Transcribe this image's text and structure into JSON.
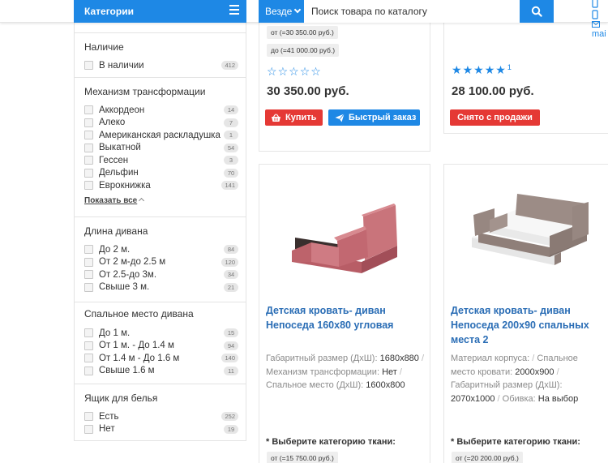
{
  "header": {
    "categories_label": "Категории",
    "search_scope": "Везде",
    "search_placeholder": "Поиск товара по каталогу",
    "mail_label": "mai"
  },
  "filters": {
    "availability": {
      "title": "Наличие",
      "options": [
        {
          "label": "В наличии",
          "count": "412"
        }
      ]
    },
    "mechanism": {
      "title": "Механизм трансформации",
      "options": [
        {
          "label": "Аккордеон",
          "count": "14"
        },
        {
          "label": "Алеко",
          "count": "7"
        },
        {
          "label": "Американская раскладушка",
          "count": "1"
        },
        {
          "label": "Выкатной",
          "count": "54"
        },
        {
          "label": "Гессен",
          "count": "3"
        },
        {
          "label": "Дельфин",
          "count": "70"
        },
        {
          "label": "Еврокнижка",
          "count": "141"
        }
      ],
      "show_all": "Показать все"
    },
    "length": {
      "title": "Длина дивана",
      "options": [
        {
          "label": "До 2 м.",
          "count": "84"
        },
        {
          "label": "От 2 м-до 2.5 м",
          "count": "120"
        },
        {
          "label": "От 2.5-до 3м.",
          "count": "34"
        },
        {
          "label": "Свыше 3 м.",
          "count": "21"
        }
      ]
    },
    "sleeping": {
      "title": "Спальное место дивана",
      "options": [
        {
          "label": "До 1 м.",
          "count": "15"
        },
        {
          "label": "От 1 м. - До 1.4 м",
          "count": "94"
        },
        {
          "label": "От 1.4 м - До 1.6 м",
          "count": "140"
        },
        {
          "label": "Свыше 1.6 м",
          "count": "11"
        }
      ]
    },
    "drawer": {
      "title": "Ящик для белья",
      "options": [
        {
          "label": "Есть",
          "count": "252"
        },
        {
          "label": "Нет",
          "count": "19"
        }
      ]
    }
  },
  "products": {
    "top_left": {
      "price_from": "от (=30 350.00 руб.)",
      "price_to": "до (=41 000.00 руб.)",
      "rating": 0,
      "price": "30 350.00 руб.",
      "buy_label": "Купить",
      "quick_label": "Быстрый заказ"
    },
    "top_right": {
      "rating": 5,
      "reviews_count": "1",
      "price": "28 100.00 руб.",
      "sold_label": "Снято с продажи"
    },
    "bottom_left": {
      "title": "Детская кровать- диван Непоседа 160х80 угловая",
      "spec1_key": "Габаритный размер (ДхШ):",
      "spec1_val": "1680х880",
      "spec2_key": "Механизм трансформации:",
      "spec2_val": "Нет",
      "spec3_key": "Спальное место (ДхШ):",
      "spec3_val": "1600х800",
      "fabric_label": "* Выберите категорию ткани:",
      "price_from": "от (=15 750.00 руб.)",
      "image_color": "#c9747b"
    },
    "bottom_right": {
      "title": "Детская кровать- диван Непоседа 200х90 спальных места 2",
      "spec1_key": "Материал корпуса:",
      "spec2_key": "Спальное место кровати:",
      "spec2_val": "2000х900",
      "spec3_key": "Габаритный размер (ДхШ):",
      "spec3_val": "2070х1000",
      "spec4_key": "Обивка:",
      "spec4_val": "На выбор",
      "fabric_label": "* Выберите категорию ткани:",
      "price_from": "от (=20 200.00 руб.)",
      "image_color": "#8f7f79"
    }
  },
  "icons": {
    "menu": "menu-icon",
    "search": "search-icon",
    "basket": "basket-icon",
    "send": "send-icon",
    "mail": "mail-icon"
  },
  "colors": {
    "primary": "#1e88e5",
    "danger": "#e53935",
    "link": "#2a6db5"
  }
}
